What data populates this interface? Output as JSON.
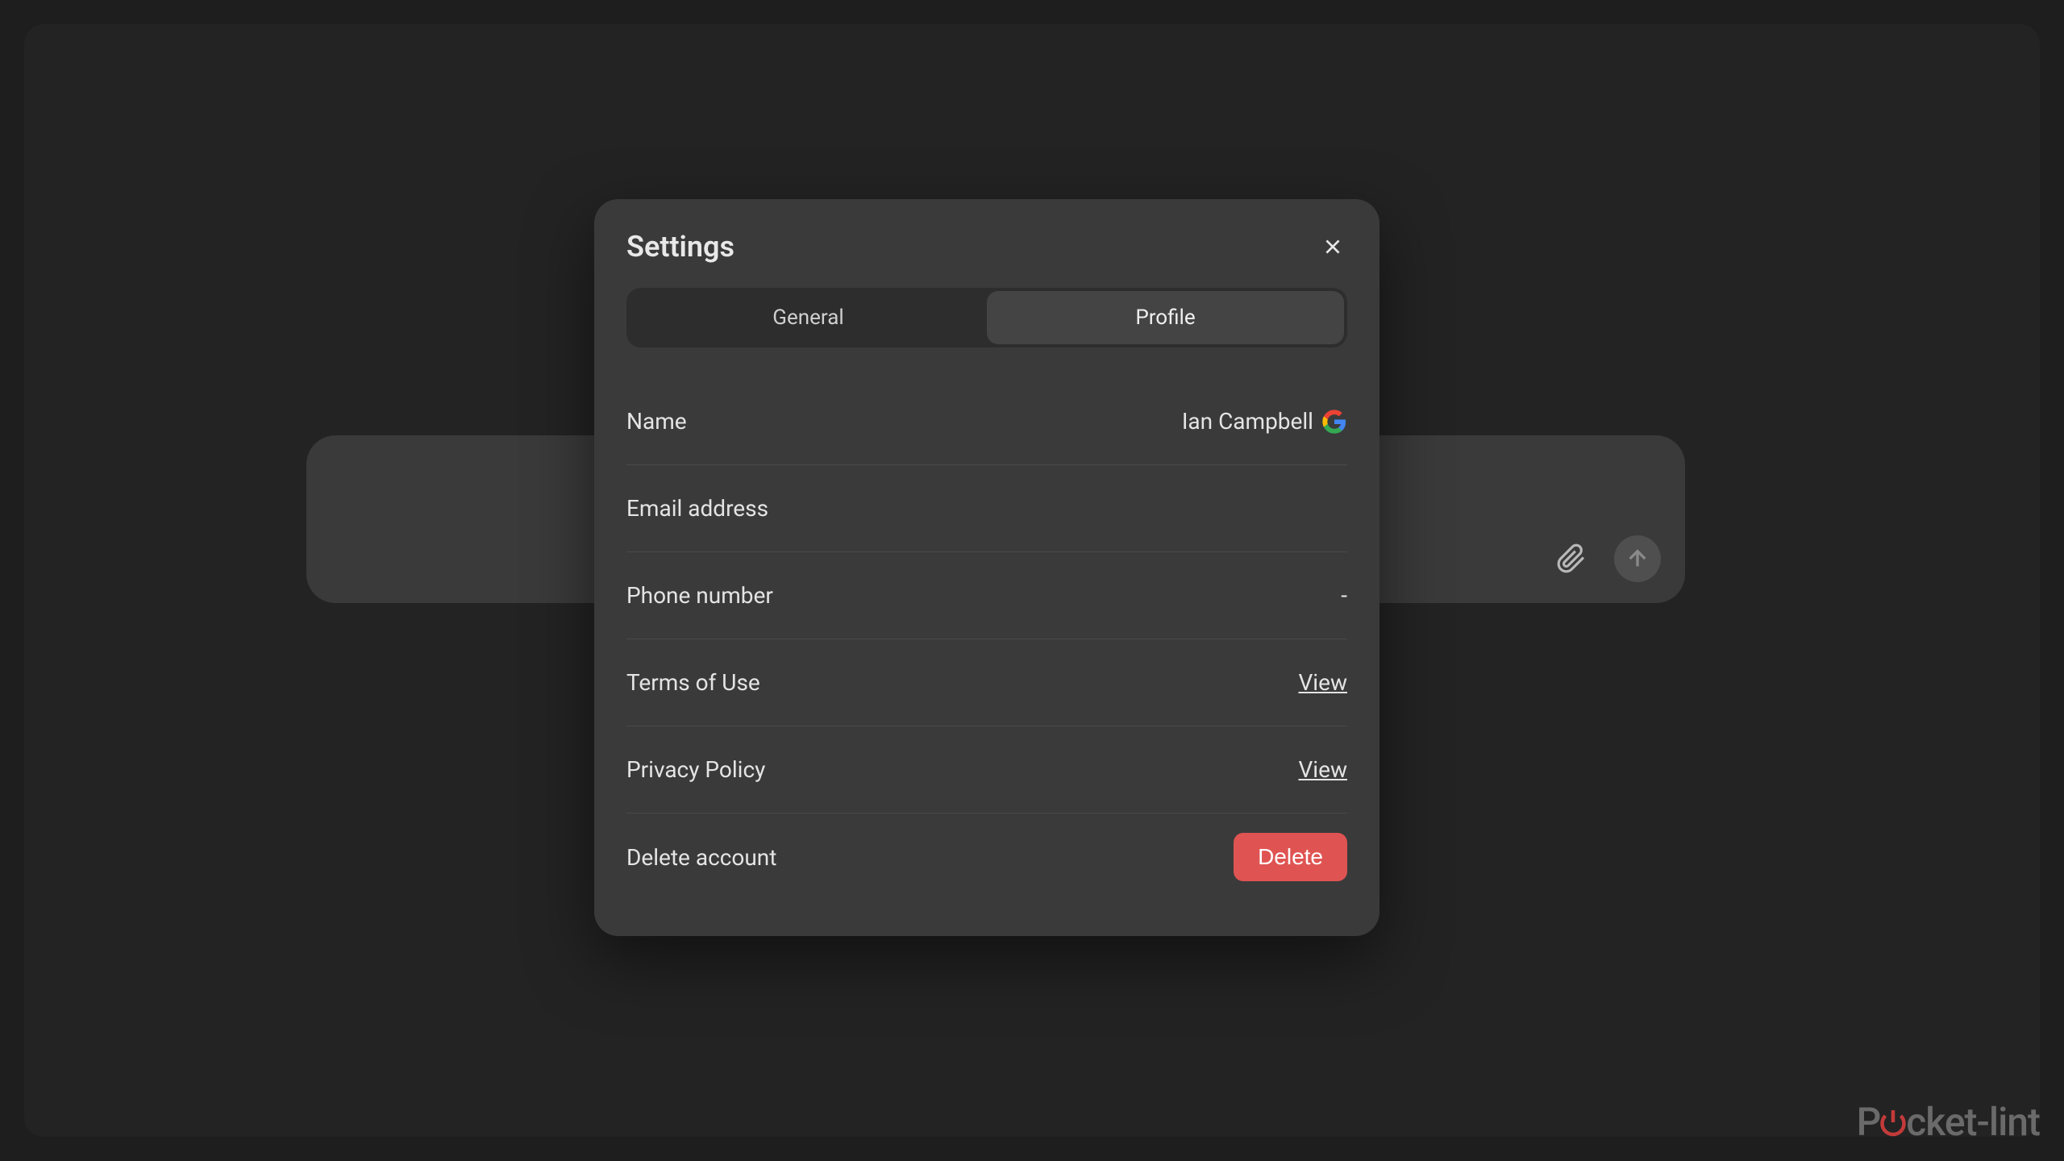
{
  "modal": {
    "title": "Settings",
    "tabs": {
      "general": "General",
      "profile": "Profile"
    },
    "rows": {
      "name": {
        "label": "Name",
        "value": "Ian Campbell"
      },
      "email": {
        "label": "Email address",
        "value": ""
      },
      "phone": {
        "label": "Phone number",
        "value": "-"
      },
      "terms": {
        "label": "Terms of Use",
        "action": "View"
      },
      "privacy": {
        "label": "Privacy Policy",
        "action": "View"
      },
      "delete": {
        "label": "Delete account",
        "action": "Delete"
      }
    }
  },
  "watermark": {
    "prefix": "P",
    "suffix": "cket-lint"
  }
}
